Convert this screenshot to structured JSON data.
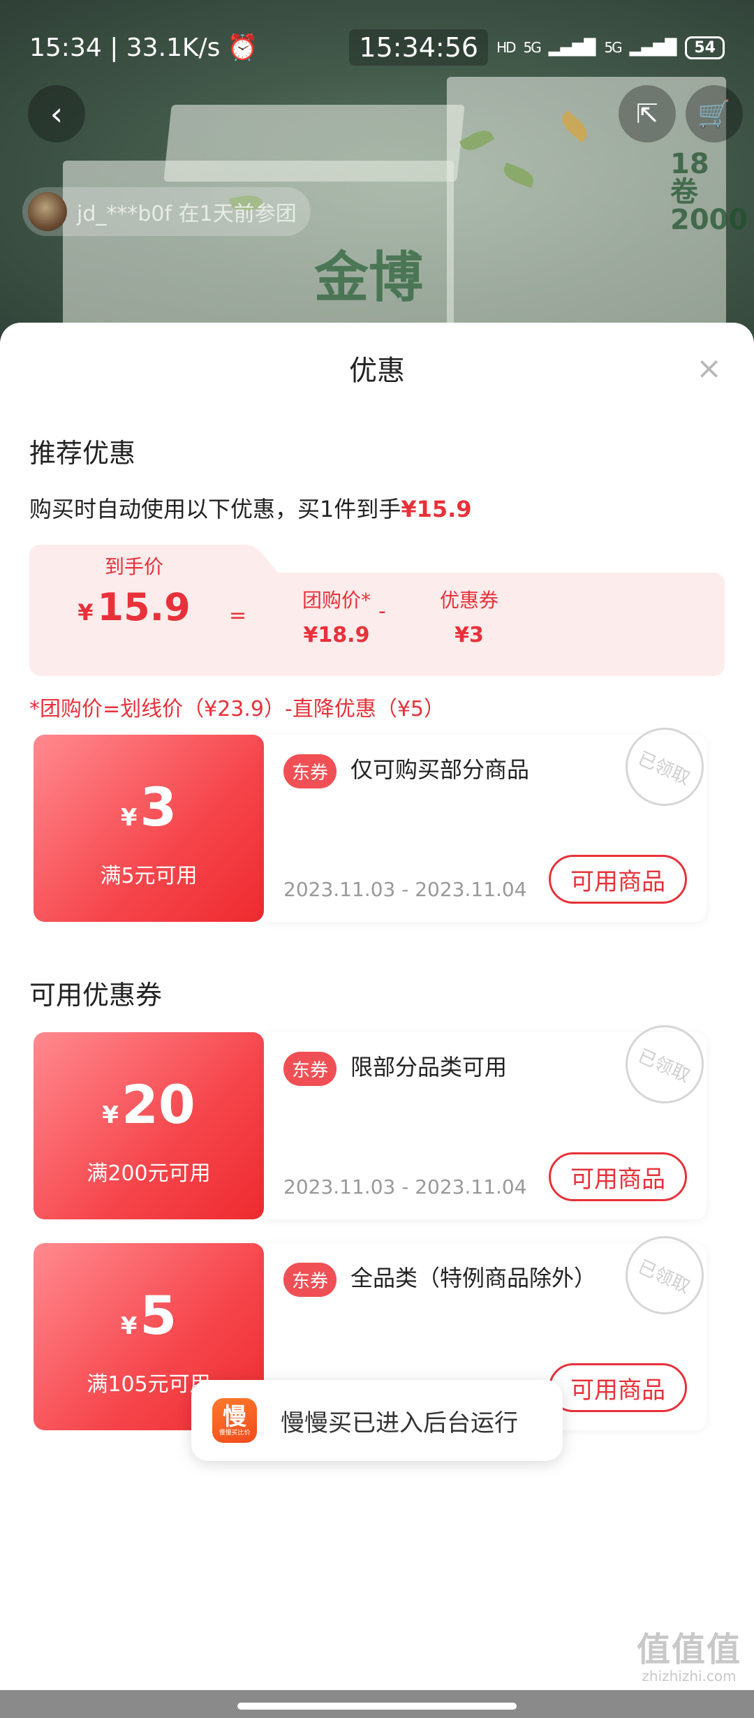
{
  "status_bar": {
    "time_left": "15:34 | 33.1K/s",
    "clock_center": "15:34:56",
    "hd_label": "HD",
    "signal1": "5G",
    "signal2": "5G",
    "battery": "54"
  },
  "product": {
    "brand_text": "金博",
    "tag_text": "18卷2000"
  },
  "group_buy": {
    "text": "jd_***b0f  在1天前参团"
  },
  "sheet": {
    "title": "优惠",
    "close": "×",
    "recommend_title": "推荐优惠",
    "recommend_desc": "购买时自动使用以下优惠，买1件到手",
    "recommend_price": "¥15.9",
    "calc": {
      "final_label": "到手价",
      "final_yen": "¥",
      "final_value": "15.9",
      "eq": "=",
      "group_label": "团购价*",
      "group_value": "¥18.9",
      "minus": "-",
      "coupon_label": "优惠券",
      "coupon_value": "¥3"
    },
    "note": "*团购价=划线价（¥23.9）-直降优惠（¥5）",
    "available_title": "可用优惠券"
  },
  "coupons": [
    {
      "yen": "¥",
      "amount": "3",
      "condition": "满5元可用",
      "tag": "东券",
      "desc": "仅可购买部分商品",
      "date": "2023.11.03 - 2023.11.04",
      "button": "可用商品",
      "stamp": "已领取"
    },
    {
      "yen": "¥",
      "amount": "20",
      "condition": "满200元可用",
      "tag": "东券",
      "desc": "限部分品类可用",
      "date": "2023.11.03 - 2023.11.04",
      "button": "可用商品",
      "stamp": "已领取"
    },
    {
      "yen": "¥",
      "amount": "5",
      "condition": "满105元可用",
      "tag": "东券",
      "desc": "全品类（特例商品除外）",
      "button": "可用商品",
      "stamp": "已领取"
    }
  ],
  "toast": {
    "icon_main": "慢",
    "icon_sub": "慢慢买比价",
    "text": "慢慢买已进入后台运行"
  },
  "watermark": {
    "big": "值值值",
    "small": "zhizhizhi.com"
  },
  "icons": [
    "back-icon",
    "share-icon",
    "cart-icon",
    "alarm-icon",
    "close-icon"
  ],
  "colors": {
    "accent_red": "#e8313a",
    "coupon_gradient_start": "#ff8a8f",
    "coupon_gradient_end": "#ee2b2f",
    "calc_bg": "#fdecec"
  }
}
